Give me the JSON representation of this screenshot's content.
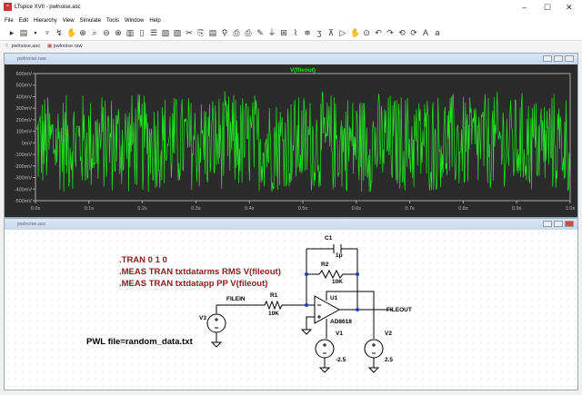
{
  "window": {
    "title": "LTspice XVII - pwlnoise.asc"
  },
  "menu": [
    "File",
    "Edit",
    "Hierarchy",
    "View",
    "Simulate",
    "Tools",
    "Window",
    "Help"
  ],
  "toolbar_icons": [
    "new",
    "open",
    "save",
    "control-panel",
    "run",
    "halt",
    "zoom-in",
    "pan",
    "zoom-out",
    "zoom-fit",
    "autorange",
    "zoom-cancel",
    "tile-horizontal",
    "cascade",
    "tile-vertical",
    "cut",
    "copy",
    "paste",
    "find",
    "print-preview",
    "print",
    "draw-wire",
    "ground",
    "label",
    "resistor",
    "capacitor",
    "inductor",
    "diode",
    "component",
    "move",
    "drag",
    "undo",
    "redo",
    "rotate",
    "mirror",
    "text",
    "spice-directive"
  ],
  "tabs": [
    {
      "label": "pwlnoise.asc"
    },
    {
      "label": "pwlnoise.raw"
    }
  ],
  "plot": {
    "window_title": "pwlnoise.raw",
    "trace_label": "V(fileout)",
    "trace_color": "#22e622",
    "y_ticks": [
      "600mV",
      "500mV",
      "400mV",
      "300mV",
      "200mV",
      "100mV",
      "0mV",
      "-100mV",
      "-200mV",
      "-300mV",
      "-400mV",
      "-500mV"
    ],
    "x_ticks": [
      "0.0s",
      "0.1s",
      "0.2s",
      "0.3s",
      "0.4s",
      "0.5s",
      "0.6s",
      "0.7s",
      "0.8s",
      "0.9s",
      "1.0s"
    ]
  },
  "schematic": {
    "window_title": "pwlnoise.asc",
    "directives": [
      ".TRAN 0 1 0",
      ".MEAS TRAN txtdatarms RMS V(fileout)",
      ".MEAS TRAN txtdatapp PP V(fileout)"
    ],
    "pwl": "PWL file=random_data.txt",
    "c1": {
      "name": "C1",
      "value": "1p"
    },
    "r2": {
      "name": "R2",
      "value": "10K"
    },
    "r1": {
      "name": "R1",
      "value": "10K"
    },
    "u1": {
      "name": "U1",
      "value": "AD8618"
    },
    "v1": {
      "name": "V1",
      "value": "-2.5"
    },
    "v2": {
      "name": "V2",
      "value": "2.5"
    },
    "v3": {
      "name": "V3"
    },
    "net_in": "FILEIN",
    "net_out": "FILEOUT"
  }
}
